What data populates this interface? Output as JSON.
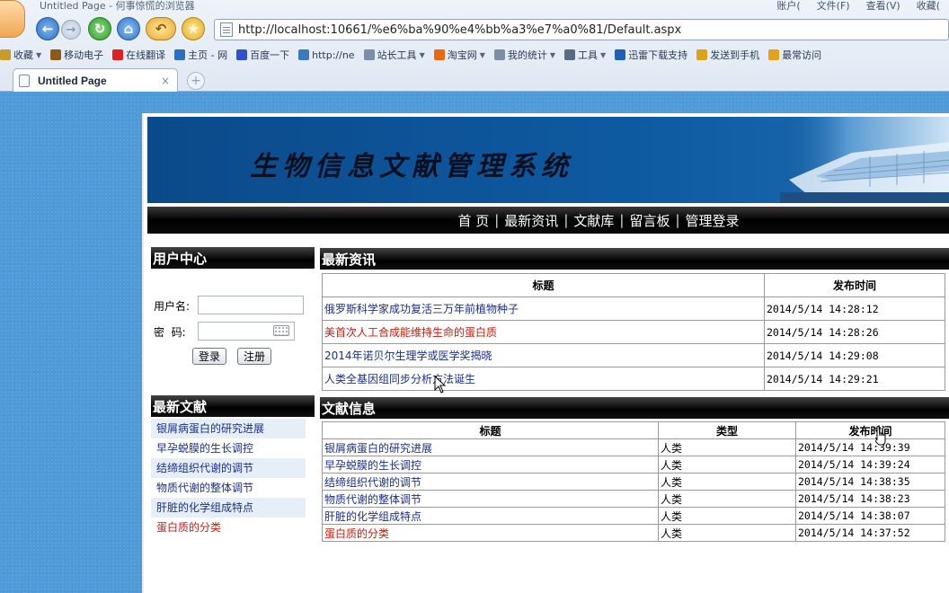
{
  "browser": {
    "window_title": "Untitled Page - 何事惊慌的浏览器",
    "menu": [
      "账户(",
      "文件(F)",
      "查看(V)",
      "收藏("
    ],
    "address": "http://localhost:10661/%e6%ba%90%e4%bb%a3%e7%a0%81/Default.aspx",
    "bookmarks": [
      {
        "label": "收藏",
        "icon": "favorites-icon",
        "caret": true,
        "color": "#c99a2e"
      },
      {
        "label": "移动电子",
        "icon": "mobile-icon",
        "caret": false,
        "color": "#8a5a1a"
      },
      {
        "label": "在线翻译",
        "icon": "translate-icon",
        "caret": false,
        "color": "#d22"
      },
      {
        "label": "主页 - 网",
        "icon": "home-page-icon",
        "caret": false,
        "color": "#2a6fc4"
      },
      {
        "label": "百度一下",
        "icon": "baidu-icon",
        "caret": false,
        "color": "#2d4fd1"
      },
      {
        "label": "http://ne",
        "icon": "stats-icon",
        "caret": false,
        "color": "#3c7ac0"
      },
      {
        "label": "站长工具",
        "icon": "page-icon",
        "caret": true,
        "color": "#7a8ea8"
      },
      {
        "label": "淘宝网",
        "icon": "taobao-icon",
        "caret": true,
        "color": "#e86a10"
      },
      {
        "label": "我的统计",
        "icon": "page-icon",
        "caret": true,
        "color": "#7a8ea8"
      },
      {
        "label": "工具",
        "icon": "tools-icon",
        "caret": true,
        "color": "#5a6c84"
      },
      {
        "label": "迅雷下载支持",
        "icon": "thunder-icon",
        "caret": false,
        "color": "#1f5fb8"
      },
      {
        "label": "发送到手机",
        "icon": "send-phone-icon",
        "caret": false,
        "color": "#d9a41c"
      },
      {
        "label": "最常访问",
        "icon": "frequent-icon",
        "caret": false,
        "color": "#e2a21a"
      }
    ],
    "tab_title": "Untitled Page",
    "tab_close": "×",
    "new_tab": "+"
  },
  "site": {
    "banner_title": "生物信息文献管理系统",
    "nav": [
      "首 页",
      "最新资讯",
      "文献库",
      "留言板",
      "管理登录"
    ],
    "nav_separator": "|"
  },
  "user_center": {
    "heading": "用户中心",
    "username_label": "用户名:",
    "password_label": "密  码:",
    "username_value": "",
    "password_value": "",
    "login_button": "登录",
    "register_button": "注册"
  },
  "latest_docs": {
    "heading": "最新文献",
    "items": [
      {
        "title": "银屑病蛋白的研究进展",
        "color": "#1a2f8a"
      },
      {
        "title": "早孕蜕膜的生长调控",
        "color": "#1a2f8a"
      },
      {
        "title": "结缔组织代谢的调节",
        "color": "#1a2f8a"
      },
      {
        "title": "物质代谢的整体调节",
        "color": "#1a2f8a"
      },
      {
        "title": "肝脏的化学组成特点",
        "color": "#1a2f8a"
      },
      {
        "title": "蛋白质的分类",
        "color": "#c02010"
      }
    ]
  },
  "news": {
    "heading": "最新资讯",
    "columns": [
      "标题",
      "发布时间"
    ],
    "rows": [
      {
        "title": "俄罗斯科学家成功复活三万年前植物种子",
        "time": "2014/5/14 14:28:12",
        "color": "#1a2f8a"
      },
      {
        "title": "美首次人工合成能维持生命的蛋白质",
        "time": "2014/5/14 14:28:26",
        "color": "#c02010"
      },
      {
        "title": "2014年诺贝尔生理学或医学奖揭晓",
        "time": "2014/5/14 14:29:08",
        "color": "#1a2f8a"
      },
      {
        "title": "人类全基因组同步分析方法诞生",
        "time": "2014/5/14 14:29:21",
        "color": "#1a2f8a"
      }
    ]
  },
  "doc_info": {
    "heading": "文献信息",
    "columns": [
      "标题",
      "类型",
      "发布时间"
    ],
    "rows": [
      {
        "title": "银屑病蛋白的研究进展",
        "type": "人类",
        "time": "2014/5/14 14:39:39",
        "color": "#1a2f8a"
      },
      {
        "title": "早孕蜕膜的生长调控",
        "type": "人类",
        "time": "2014/5/14 14:39:24",
        "color": "#1a2f8a"
      },
      {
        "title": "结缔组织代谢的调节",
        "type": "人类",
        "time": "2014/5/14 14:38:35",
        "color": "#1a2f8a"
      },
      {
        "title": "物质代谢的整体调节",
        "type": "人类",
        "time": "2014/5/14 14:38:23",
        "color": "#1a2f8a"
      },
      {
        "title": "肝脏的化学组成特点",
        "type": "人类",
        "time": "2014/5/14 14:38:07",
        "color": "#1a2f8a"
      },
      {
        "title": "蛋白质的分类",
        "type": "人类",
        "time": "2014/5/14 14:37:52",
        "color": "#c02010"
      }
    ]
  }
}
